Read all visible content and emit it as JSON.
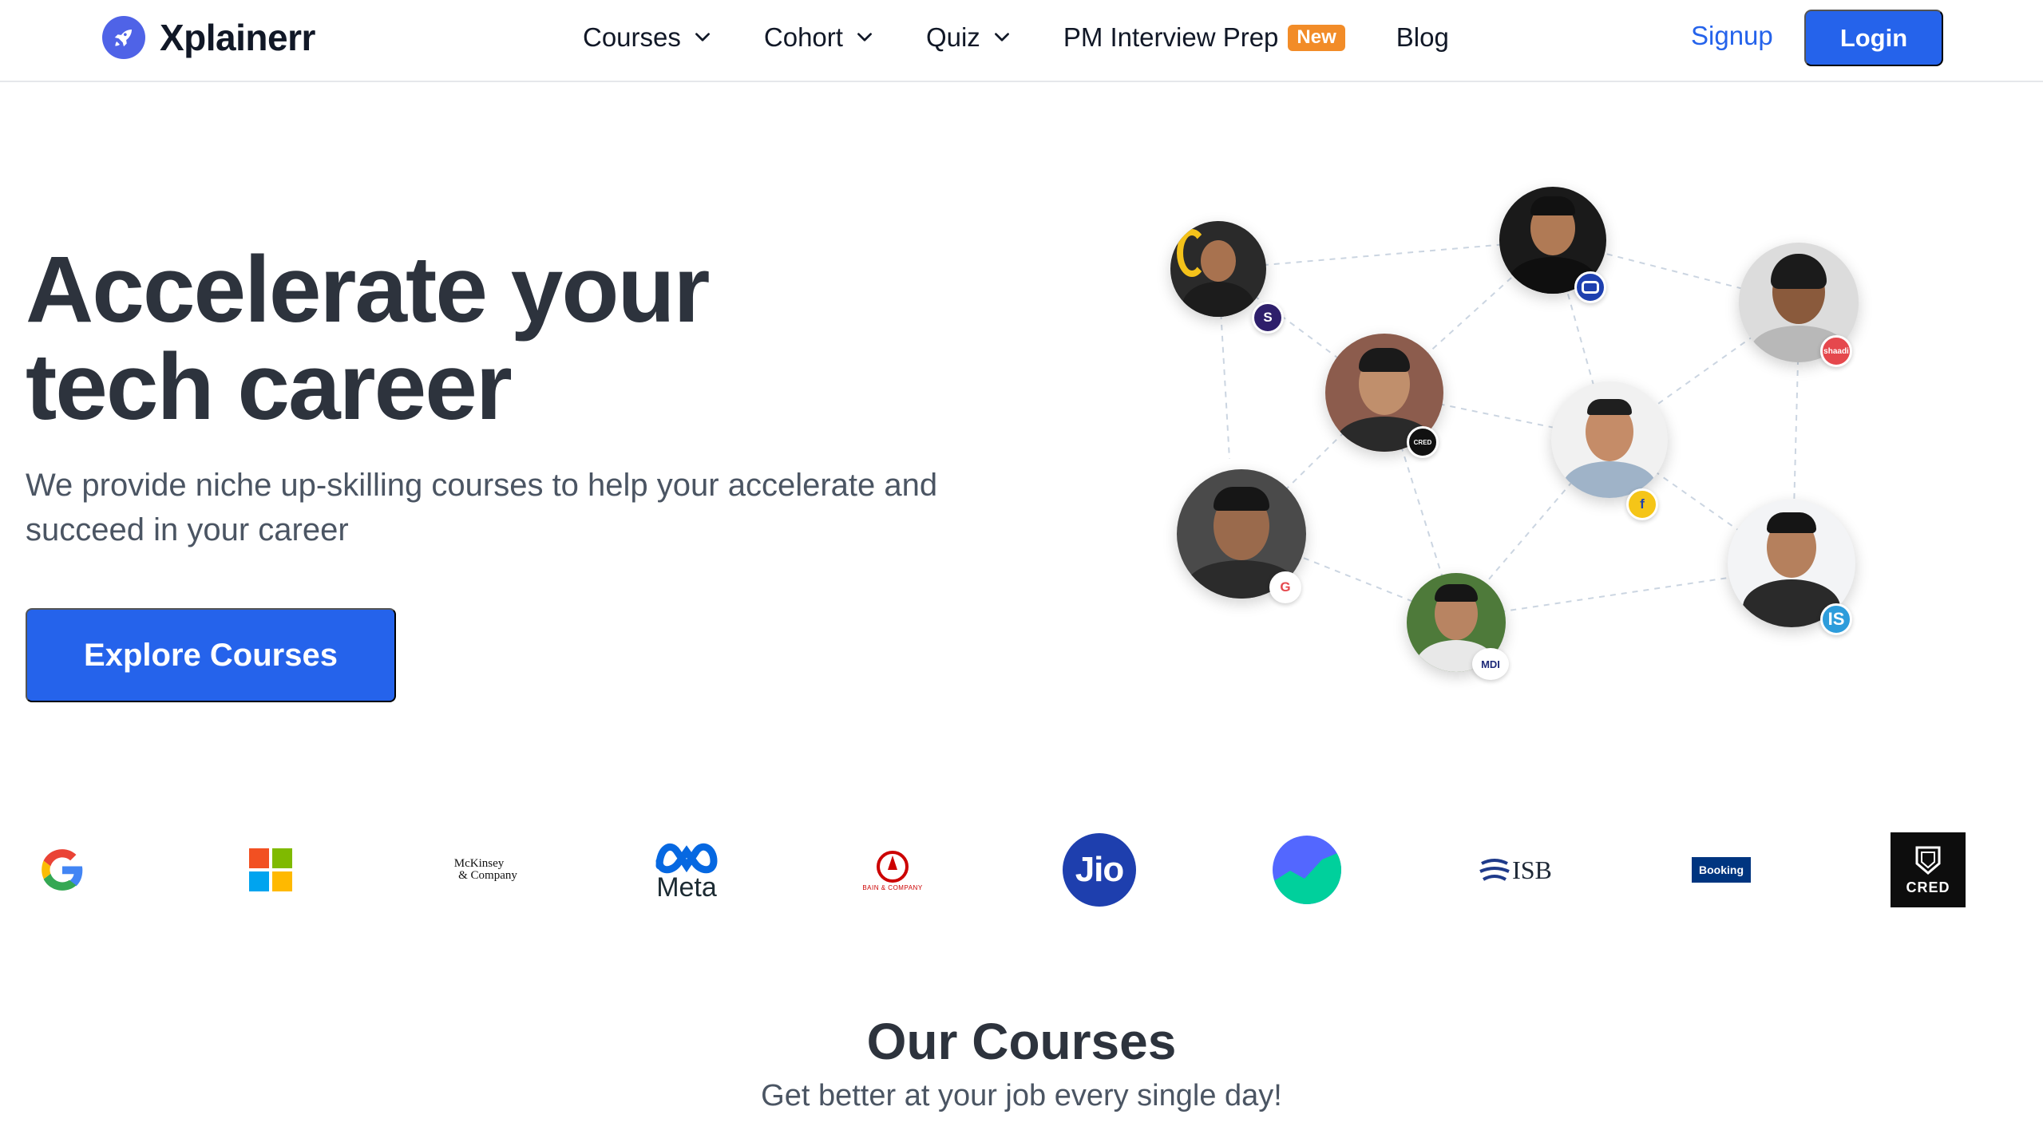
{
  "brand": {
    "name": "Xplainerr",
    "icon": "rocket-icon",
    "accent": "#2563eb"
  },
  "nav": {
    "items": [
      {
        "label": "Courses",
        "has_dropdown": true
      },
      {
        "label": "Cohort",
        "has_dropdown": true
      },
      {
        "label": "Quiz",
        "has_dropdown": true
      },
      {
        "label": "PM Interview Prep",
        "badge": "New",
        "has_dropdown": false
      },
      {
        "label": "Blog",
        "has_dropdown": false
      }
    ],
    "signup_label": "Signup",
    "login_label": "Login"
  },
  "hero": {
    "title_line1": "Accelerate your",
    "title_line2": "tech career",
    "subtitle": "We provide niche up-skilling courses to help your accelerate and succeed in your career",
    "cta_label": "Explore Courses"
  },
  "network": {
    "mentors": [
      {
        "badge_text": "S",
        "badge_color": "#2e1f6b"
      },
      {
        "badge_text": "",
        "badge_color": "#1e40af"
      },
      {
        "badge_text": "shaadi",
        "badge_color": "#e5484d"
      },
      {
        "badge_text": "CRED",
        "badge_color": "#111111"
      },
      {
        "badge_text": "f",
        "badge_color": "#f5c518"
      },
      {
        "badge_text": "G",
        "badge_color": "#ffffff"
      },
      {
        "badge_text": "MDI",
        "badge_color": "#ffffff"
      },
      {
        "badge_text": "IS",
        "badge_color": "#2d9cdb"
      }
    ]
  },
  "companies": {
    "mckinsey_line1": "McKinsey",
    "mckinsey_line2": "& Company",
    "meta": "Meta",
    "bain": "BAIN & COMPANY",
    "jio": "Jio",
    "isb": "ISB",
    "booking": "Booking",
    "cred": "CRED"
  },
  "courses": {
    "title": "Our Courses",
    "subtitle": "Get better at your job every single day!"
  }
}
